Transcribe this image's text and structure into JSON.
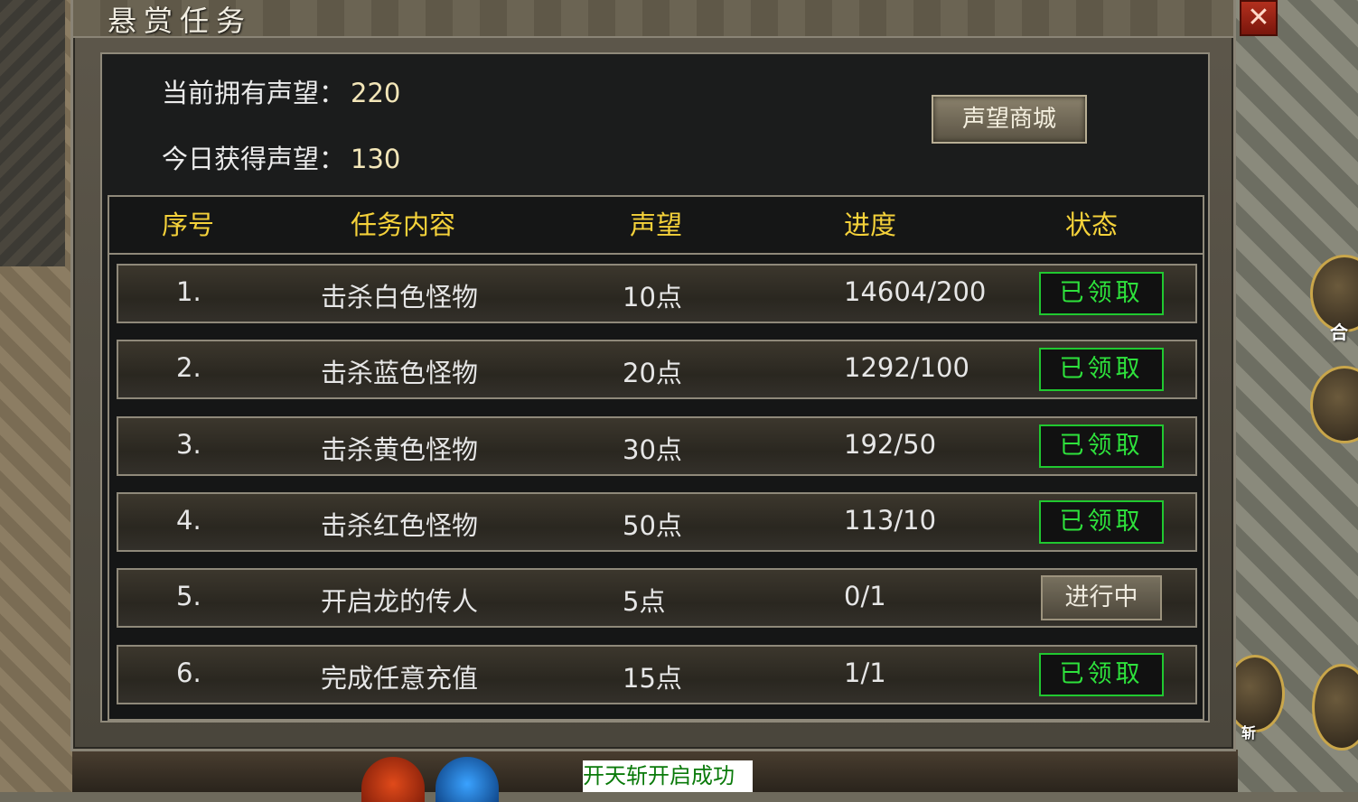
{
  "window": {
    "title": "悬赏任务",
    "close_label": "✕"
  },
  "reputation": {
    "current_label": "当前拥有声望：",
    "current_value": "220",
    "today_label": "今日获得声望：",
    "today_value": "130",
    "shop_button": "声望商城"
  },
  "table": {
    "headers": [
      "序号",
      "任务内容",
      "声望",
      "进度",
      "状态"
    ],
    "rows": [
      {
        "index": "1.",
        "task": "击杀白色怪物",
        "reputation": "10点",
        "progress": "14604/200",
        "status": "已领取",
        "state": "done"
      },
      {
        "index": "2.",
        "task": "击杀蓝色怪物",
        "reputation": "20点",
        "progress": "1292/100",
        "status": "已领取",
        "state": "done"
      },
      {
        "index": "3.",
        "task": "击杀黄色怪物",
        "reputation": "30点",
        "progress": "192/50",
        "status": "已领取",
        "state": "done"
      },
      {
        "index": "4.",
        "task": "击杀红色怪物",
        "reputation": "50点",
        "progress": "113/10",
        "status": "已领取",
        "state": "done"
      },
      {
        "index": "5.",
        "task": "开启龙的传人",
        "reputation": "5点",
        "progress": "0/1",
        "status": "进行中",
        "state": "in-progress"
      },
      {
        "index": "6.",
        "task": "完成任意充值",
        "reputation": "15点",
        "progress": "1/1",
        "status": "已领取",
        "state": "done"
      }
    ]
  },
  "background": {
    "message": "开天斩开启成功",
    "side_label_1": "合",
    "side_label_2": "斩"
  },
  "colors": {
    "header_text": "#f5d23a",
    "claimed_green": "#2ee23c",
    "close_red": "#b2301e"
  }
}
